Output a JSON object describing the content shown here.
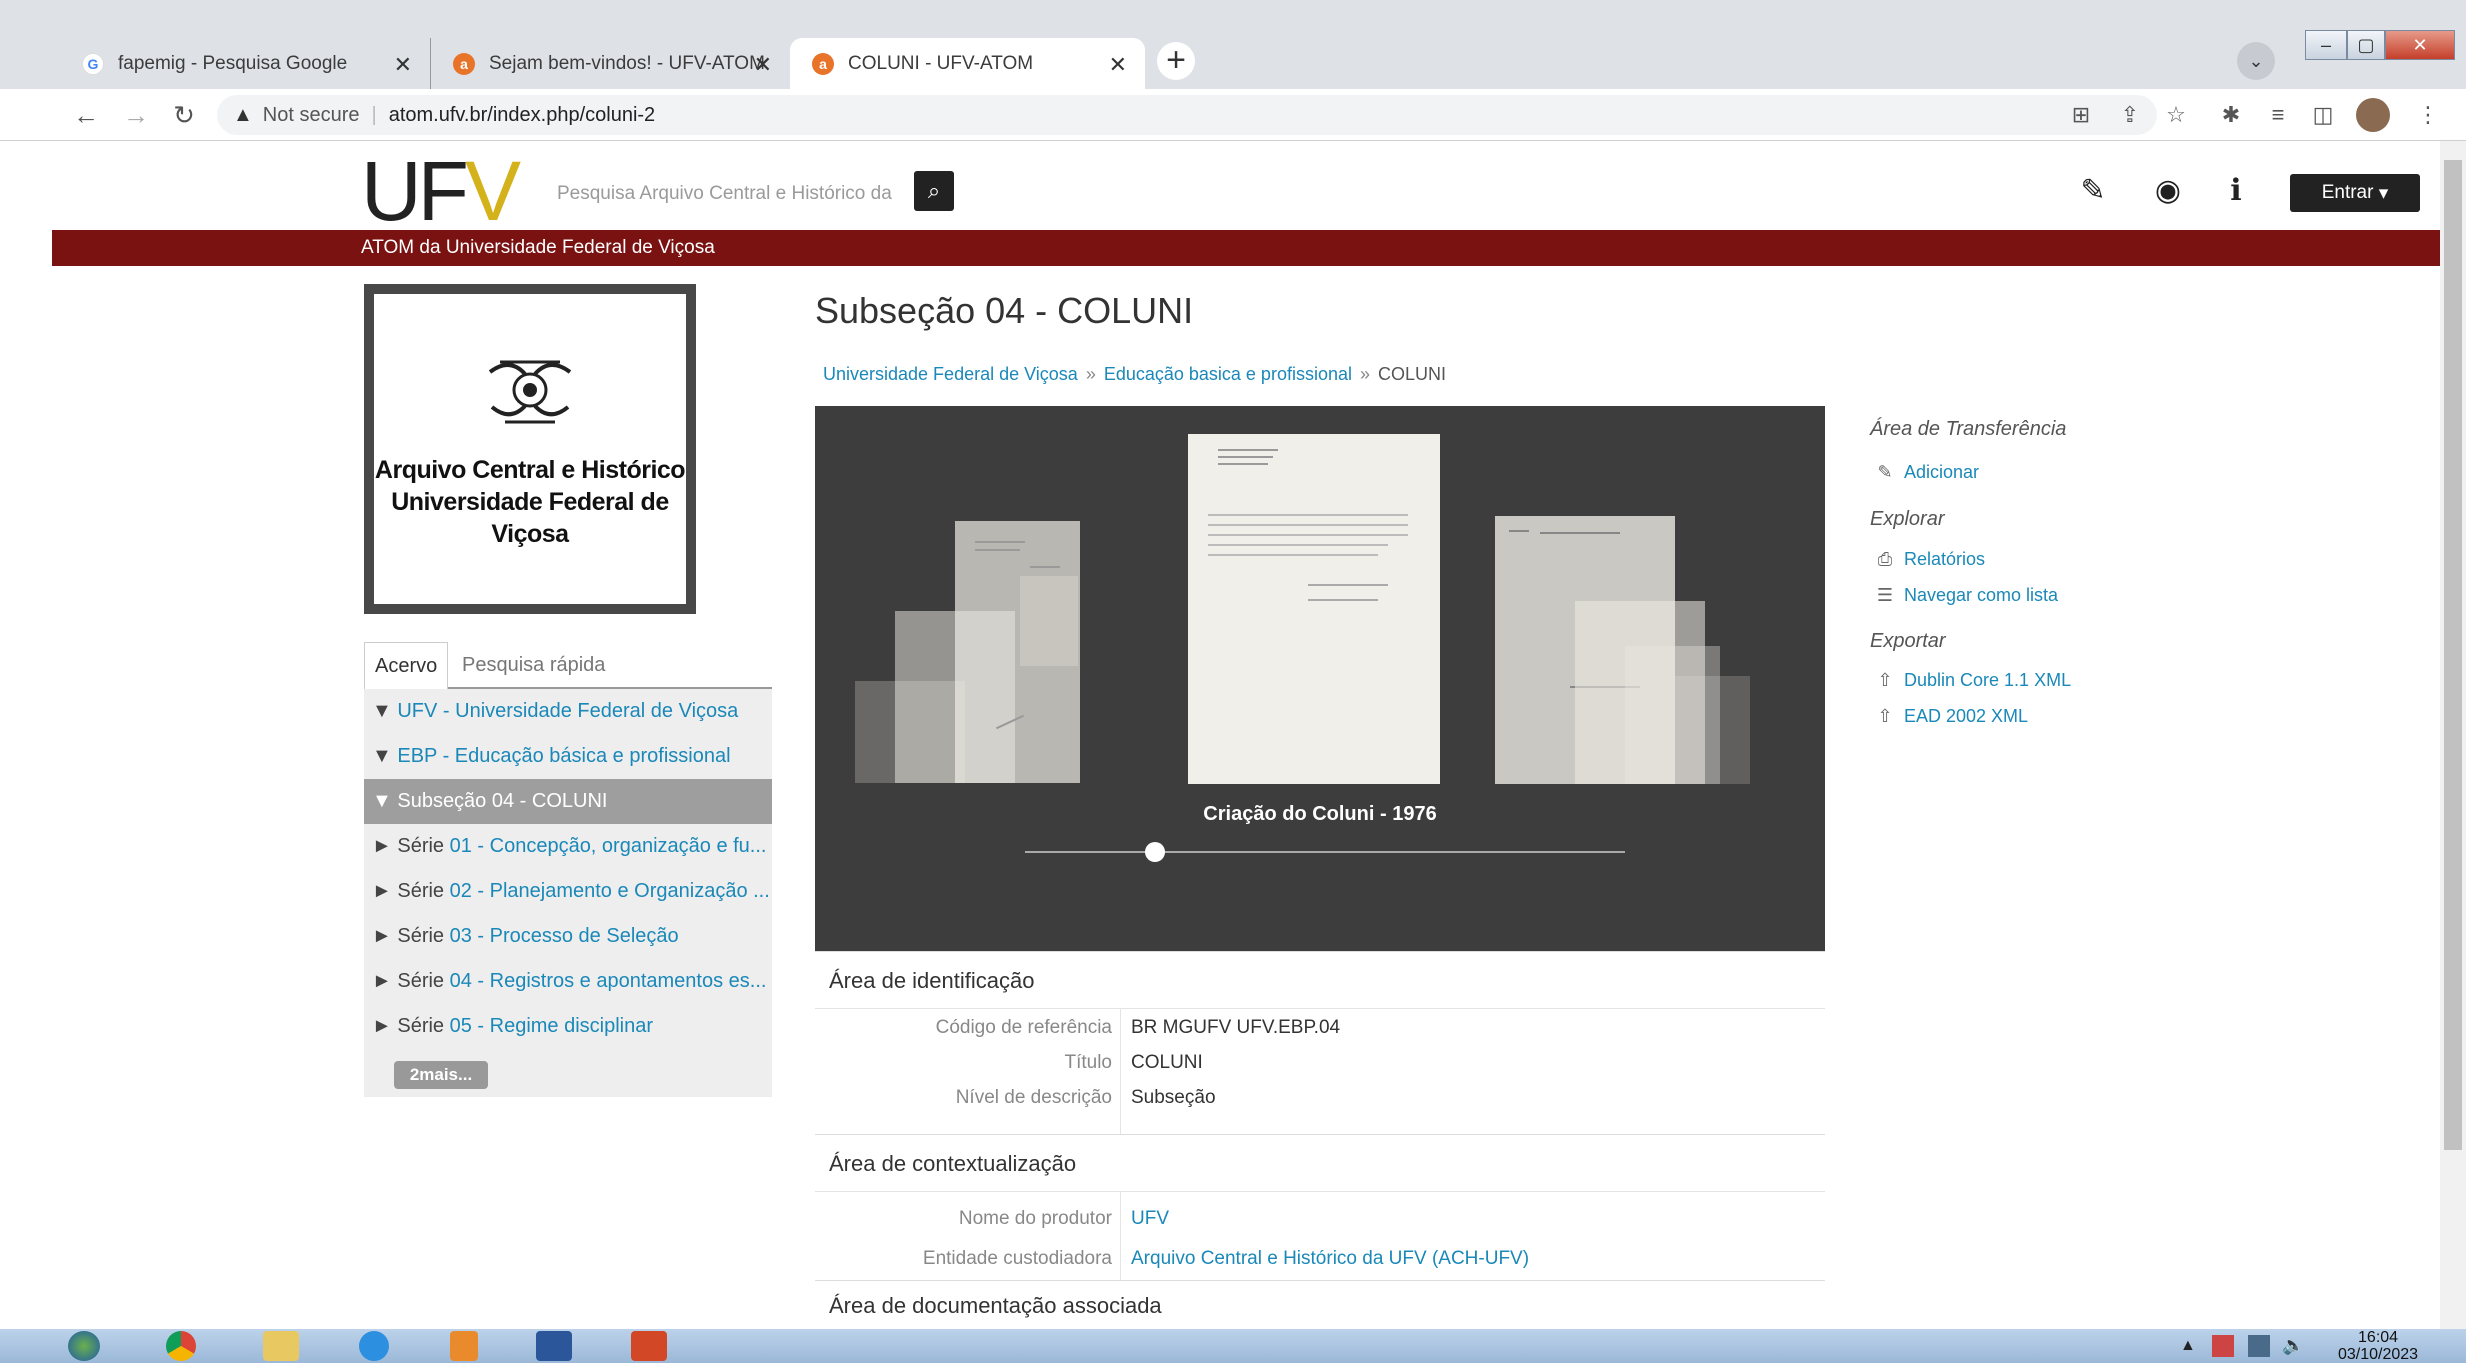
{
  "browser": {
    "tabs": [
      {
        "title": "fapemig - Pesquisa Google",
        "icon": "google-icon",
        "active": false
      },
      {
        "title": "Sejam bem-vindos! - UFV-ATOM",
        "icon": "atom-icon",
        "active": false
      },
      {
        "title": "COLUNI - UFV-ATOM",
        "icon": "atom-icon",
        "active": true
      }
    ],
    "new_tab": "+",
    "security": "Not secure",
    "url": "atom.ufv.br/index.php/coluni-2"
  },
  "header": {
    "logo": {
      "u": "U",
      "f": "F",
      "v": "V"
    },
    "search_placeholder": "Pesquisa Arquivo Central e Histórico da",
    "login_label": "Entrar",
    "subtitle": "ATOM da Universidade Federal de Viçosa"
  },
  "left": {
    "repository_name_line1": "Arquivo Central e Histórico",
    "repository_name_line2": "Universidade Federal de Viçosa",
    "tabs": [
      "Acervo",
      "Pesquisa rápida"
    ],
    "tree": [
      {
        "prefix": "▼ ",
        "label": "UFV - Universidade Federal de Viçosa"
      },
      {
        "prefix": "▼ ",
        "label": "EBP - Educação básica e profissional"
      },
      {
        "prefix": "▼ Subseção ",
        "label": "04 - COLUNI"
      },
      {
        "prefix": "► Série ",
        "label": "01 - Concepção, organização e fu..."
      },
      {
        "prefix": "► Série ",
        "label": "02 - Planejamento e Organização ..."
      },
      {
        "prefix": "► Série ",
        "label": "03 - Processo de Seleção"
      },
      {
        "prefix": "► Série ",
        "label": "04 - Registros e apontamentos es..."
      },
      {
        "prefix": "► Série ",
        "label": "05 - Regime disciplinar"
      }
    ],
    "more": "2mais..."
  },
  "main": {
    "title": "Subseção 04 - COLUNI",
    "breadcrumb": [
      "Universidade Federal de Viçosa",
      "Educação basica e profissional",
      "COLUNI"
    ],
    "breadcrumb_sep": "»",
    "carousel_caption": "Criação do Coluni - 1976",
    "identification": {
      "heading": "Área de identificação",
      "fields": [
        {
          "label": "Código de referência",
          "value": "BR MGUFV UFV.EBP.04"
        },
        {
          "label": "Título",
          "value": "COLUNI"
        },
        {
          "label": "Nível de descrição",
          "value": "Subseção"
        }
      ]
    },
    "context": {
      "heading": "Área de contextualização",
      "fields": [
        {
          "label": "Nome do produtor",
          "value": "UFV"
        },
        {
          "label": "Entidade custodiadora",
          "value": "Arquivo Central e Histórico da UFV (ACH-UFV)"
        }
      ]
    },
    "documentation_heading": "Área de documentação associada"
  },
  "right": {
    "clipboard_heading": "Área de Transferência",
    "add": "Adicionar",
    "explore_heading": "Explorar",
    "reports": "Relatórios",
    "browse_list": "Navegar como lista",
    "export_heading": "Exportar",
    "dublin": "Dublin Core 1.1 XML",
    "ead": "EAD 2002 XML"
  },
  "taskbar": {
    "time": "16:04",
    "date": "03/10/2023"
  }
}
